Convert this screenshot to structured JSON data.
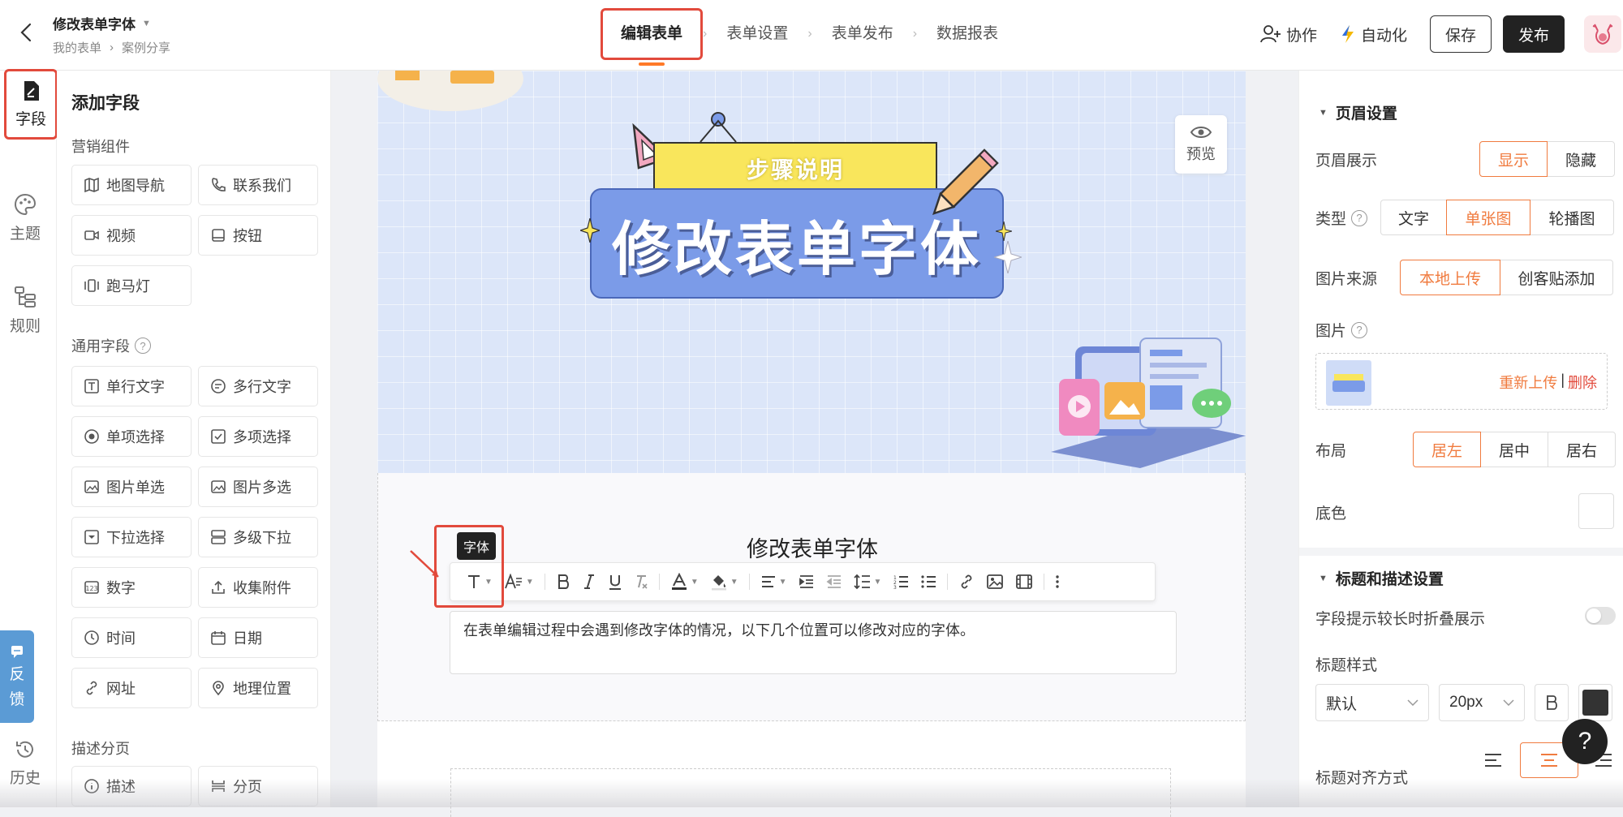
{
  "app": {
    "form_title": "修改表单字体",
    "breadcrumb": [
      "我的表单",
      "案例分享"
    ],
    "steps": [
      "编辑表单",
      "表单设置",
      "表单发布",
      "数据报表"
    ],
    "collaborate": "协作",
    "automation": "自动化",
    "save": "保存",
    "publish": "发布"
  },
  "rail": {
    "fields": "字段",
    "theme": "主题",
    "rules": "规则",
    "history": "历史",
    "feedback": "反馈"
  },
  "fields_panel": {
    "title": "添加字段",
    "marketing_title": "营销组件",
    "marketing": [
      "地图导航",
      "联系我们",
      "视频",
      "按钮",
      "跑马灯"
    ],
    "general_title": "通用字段",
    "general": [
      "单行文字",
      "多行文字",
      "单项选择",
      "多项选择",
      "图片单选",
      "图片多选",
      "下拉选择",
      "多级下拉",
      "数字",
      "收集附件",
      "时间",
      "日期",
      "网址",
      "地理位置"
    ],
    "paging_title": "描述分页",
    "paging": [
      "描述",
      "分页"
    ]
  },
  "canvas": {
    "preview": "预览",
    "banner_sign_small": "步骤说明",
    "banner_sign_big": "修改表单字体",
    "form_title": "修改表单字体",
    "tooltip": "字体",
    "description": "在表单编辑过程中会遇到修改字体的情况，以下几个位置可以修改对应的字体。"
  },
  "props": {
    "header_section": "页眉设置",
    "header_display_label": "页眉展示",
    "header_display_options": [
      "显示",
      "隐藏"
    ],
    "type_label": "类型",
    "type_options": [
      "文字",
      "单张图",
      "轮播图"
    ],
    "source_label": "图片来源",
    "source_options": [
      "本地上传",
      "创客贴添加"
    ],
    "image_label": "图片",
    "reupload": "重新上传",
    "delete": "删除",
    "layout_label": "布局",
    "layout_options": [
      "居左",
      "居中",
      "居右"
    ],
    "bg_label": "底色",
    "title_section": "标题和描述设置",
    "fold_label": "字段提示较长时折叠展示",
    "title_style_label": "标题样式",
    "title_font_value": "默认",
    "title_size_value": "20px",
    "align_label": "标题对齐方式"
  },
  "help": "?",
  "colors": {
    "accent": "#f07b3f",
    "highlight": "#e24a3c",
    "feedback": "#5b9bd5",
    "delete": "#e24a3c",
    "text_color_swatch": "#333333"
  }
}
